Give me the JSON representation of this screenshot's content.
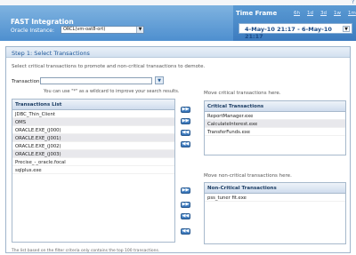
{
  "header": {
    "app_title": "FAST Integration",
    "oracle_label": "Oracle Instance:",
    "instance_value": "ORCL(vm-oat8-ort)",
    "help_icon": "?"
  },
  "timeframe": {
    "title": "Time Frame",
    "links": [
      "6h",
      "1d",
      "3d",
      "1w",
      "1m"
    ],
    "range": "4-May-10  21:17  -  6-May-10  21:17"
  },
  "step": {
    "title": "Step 1: Select Transactions",
    "instructions": "Select critical transactions to promote and non-critical transactions to demote.",
    "transaction_label": "Transaction(s):",
    "transaction_value": "",
    "hint": "You can use \"*\" as a wildcard to improve your search results.",
    "footnote": "The list based on the filter criteria only contains the top 100 transactions."
  },
  "transactions_list": {
    "header": "Transactions List",
    "items": [
      "JDBC_Thin_Client",
      "OMS",
      "ORACLE.EXE_(J000)",
      "ORACLE.EXE_(J001)",
      "ORACLE.EXE_(J002)",
      "ORACLE.EXE_(J003)",
      "Precise_-_oracle.focal",
      "sqlplus.exe"
    ]
  },
  "critical": {
    "move_label": "Move critical transactions here.",
    "header": "Critical Transactions",
    "items": [
      "ReportManager.exe",
      "CalculateInterest.exe",
      "TransferFunds.exe"
    ]
  },
  "noncritical": {
    "move_label": "Move non-critical transactions here.",
    "header": "Non-Critical Transactions",
    "items": [
      "pss_tuner fit.exe"
    ]
  },
  "arrows": {
    "right": "▶▶",
    "left": "◀◀"
  }
}
